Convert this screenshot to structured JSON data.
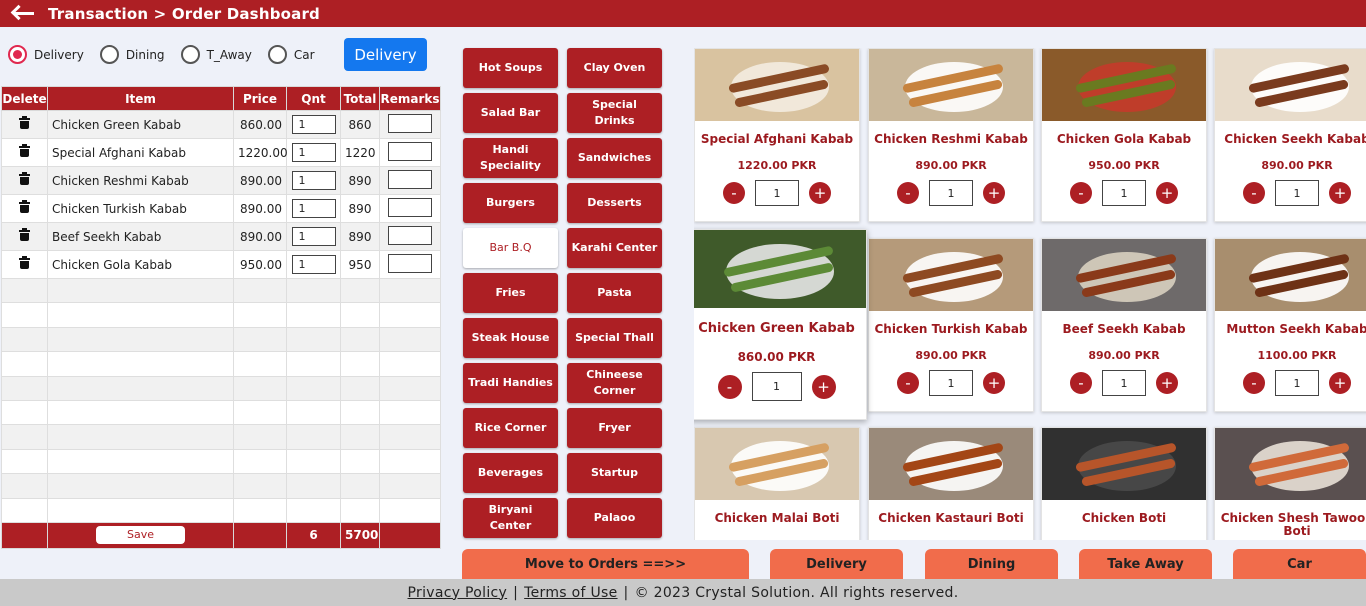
{
  "header": {
    "title": "Transaction > Order Dashboard"
  },
  "order_type": {
    "options": [
      "Delivery",
      "Dining",
      "T_Away",
      "Car"
    ],
    "selected": "Delivery",
    "mode_button": "Delivery"
  },
  "order_table": {
    "columns": [
      "Delete",
      "Item",
      "Price",
      "Qnt",
      "Total",
      "Remarks"
    ],
    "rows": [
      {
        "item": "Chicken Green Kabab",
        "price": "860.00",
        "qty": "1",
        "total": "860"
      },
      {
        "item": "Special Afghani Kabab",
        "price": "1220.00",
        "qty": "1",
        "total": "1220"
      },
      {
        "item": "Chicken Reshmi Kabab",
        "price": "890.00",
        "qty": "1",
        "total": "890"
      },
      {
        "item": "Chicken Turkish Kabab",
        "price": "890.00",
        "qty": "1",
        "total": "890"
      },
      {
        "item": "Beef Seekh Kabab",
        "price": "890.00",
        "qty": "1",
        "total": "890"
      },
      {
        "item": "Chicken Gola Kabab",
        "price": "950.00",
        "qty": "1",
        "total": "950"
      }
    ],
    "footer": {
      "save_label": "Save",
      "total_qty": "6",
      "grand_total": "5700"
    }
  },
  "categories": [
    [
      "Hot Soups",
      "Clay Oven"
    ],
    [
      "Salad Bar",
      "Special Drinks"
    ],
    [
      "Handi Speciality",
      "Sandwiches"
    ],
    [
      "Burgers",
      "Desserts"
    ],
    [
      "Bar B.Q",
      "Karahi Center"
    ],
    [
      "Fries",
      "Pasta"
    ],
    [
      "Steak House",
      "Special Thall"
    ],
    [
      "Tradi Handies",
      "Chineese Corner"
    ],
    [
      "Rice Corner",
      "Fryer"
    ],
    [
      "Beverages",
      "Startup"
    ],
    [
      "Biryani Center",
      "Palaoo"
    ]
  ],
  "active_category": "Bar B.Q",
  "products": [
    {
      "name": "Special Afghani Kabab",
      "price": "1220.00 PKR",
      "qty": "1"
    },
    {
      "name": "Chicken Reshmi Kabab",
      "price": "890.00 PKR",
      "qty": "1"
    },
    {
      "name": "Chicken Gola Kabab",
      "price": "950.00 PKR",
      "qty": "1"
    },
    {
      "name": "Chicken Seekh Kabab",
      "price": "890.00 PKR",
      "qty": "1"
    },
    {
      "name": "Chicken Green Kabab",
      "price": "860.00 PKR",
      "qty": "1"
    },
    {
      "name": "Chicken Turkish Kabab",
      "price": "890.00 PKR",
      "qty": "1"
    },
    {
      "name": "Beef Seekh Kabab",
      "price": "890.00 PKR",
      "qty": "1"
    },
    {
      "name": "Mutton Seekh Kabab",
      "price": "1100.00 PKR",
      "qty": "1"
    },
    {
      "name": "Chicken Malai Boti",
      "price": "",
      "qty": ""
    },
    {
      "name": "Chicken Kastauri Boti",
      "price": "",
      "qty": ""
    },
    {
      "name": "Chicken Boti",
      "price": "",
      "qty": ""
    },
    {
      "name": "Chicken Shesh Tawook Boti",
      "price": "",
      "qty": ""
    }
  ],
  "stepper": {
    "minus": "-",
    "plus": "+"
  },
  "actions": [
    "Move to Orders ==>>",
    "Delivery",
    "Dining",
    "Take Away",
    "Car"
  ],
  "footer": {
    "privacy": "Privacy Policy",
    "sep": "|",
    "terms": "Terms of Use",
    "copyright": "© 2023 Crystal Solution. All rights reserved."
  },
  "colors": {
    "brand": "#ad1f24",
    "accent_blue": "#1478ef",
    "action_orange": "#f16c4b"
  },
  "icons": {
    "back": "arrow-left-icon",
    "delete": "trash-icon"
  }
}
